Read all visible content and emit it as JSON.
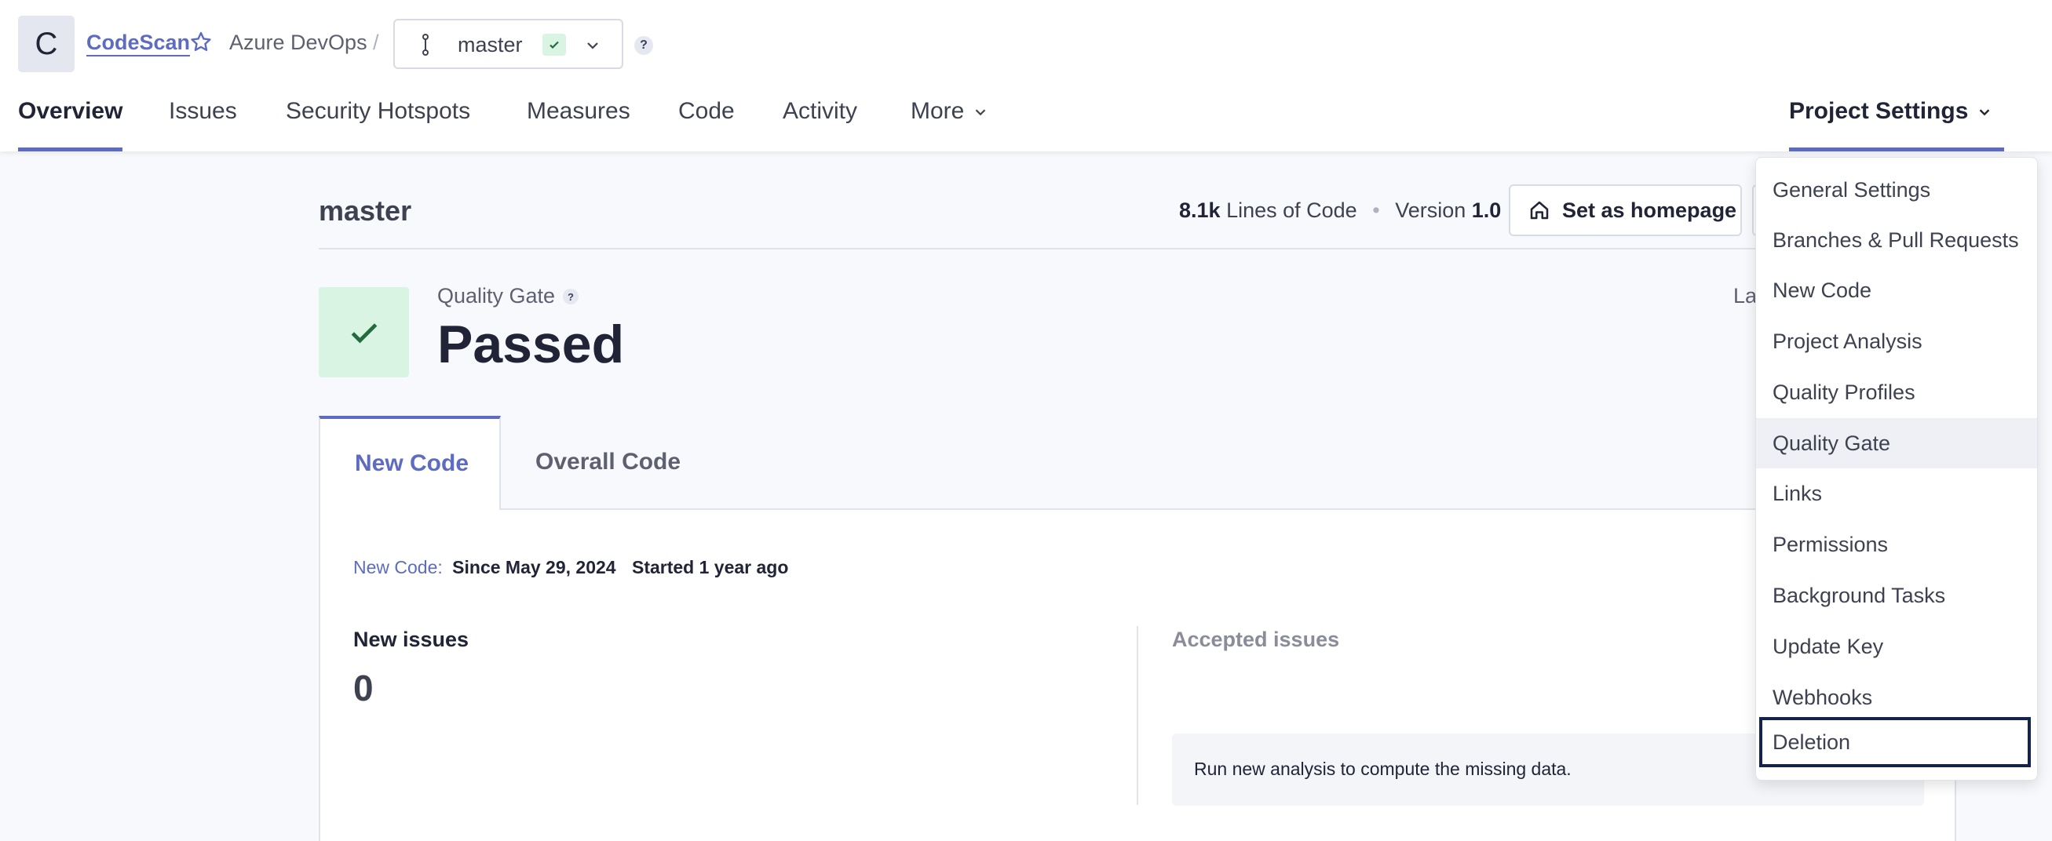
{
  "header": {
    "avatar_letter": "C",
    "project_name": "CodeScan",
    "organization": "Azure DevOps",
    "separator": "/",
    "branch": "master",
    "help": "?"
  },
  "nav": {
    "items": [
      "Overview",
      "Issues",
      "Security Hotspots",
      "Measures",
      "Code",
      "Activity",
      "More"
    ],
    "active": "Overview",
    "project_settings": "Project Settings"
  },
  "main": {
    "title": "master",
    "loc_value": "8.1k",
    "loc_label": "Lines of Code",
    "version_label": "Version",
    "version_value": "1.0",
    "homepage_button": "Set as homepage",
    "quality_gate_label": "Quality Gate",
    "quality_gate_status": "Passed",
    "last_analysis_partial": "La",
    "tabs": [
      "New Code",
      "Overall Code"
    ],
    "active_tab": "New Code",
    "new_code_label": "New Code:",
    "new_code_since": "Since May 29, 2024",
    "new_code_started": "Started 1 year ago",
    "new_issues_label": "New issues",
    "new_issues_value": "0",
    "accepted_issues_label": "Accepted issues",
    "missing_data_message": "Run new analysis to compute the missing data."
  },
  "settings_menu": {
    "items": [
      "General Settings",
      "Branches & Pull Requests",
      "New Code",
      "Project Analysis",
      "Quality Profiles",
      "Quality Gate",
      "Links",
      "Permissions",
      "Background Tasks",
      "Update Key",
      "Webhooks",
      "Deletion"
    ],
    "hovered": "Quality Gate",
    "focused": "Deletion"
  },
  "colors": {
    "accent": "#5d6cc0",
    "success_bg": "#d9f4e2",
    "success_fg": "#236a3e",
    "focus_border": "#14234b"
  }
}
